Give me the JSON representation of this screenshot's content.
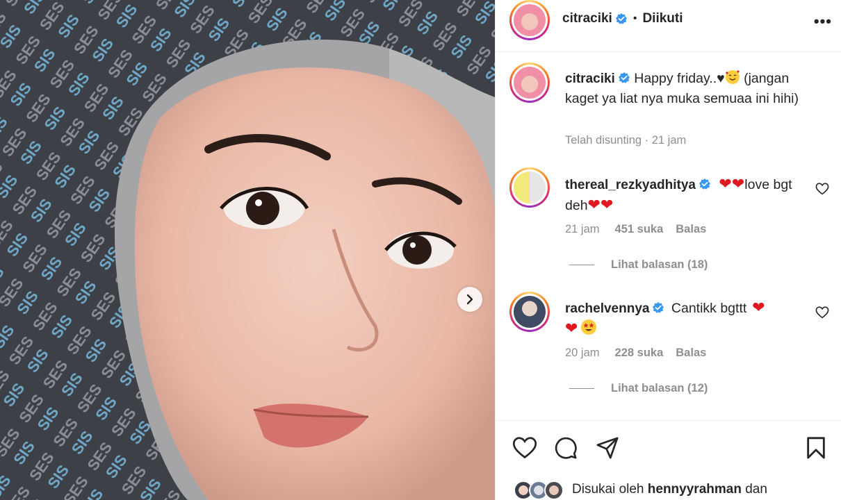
{
  "post": {
    "author": "citraciki",
    "follow_status": "Diikuti",
    "more_label": "•••",
    "caption_author": "citraciki",
    "caption_text": "Happy friday..",
    "caption_rest": "(jangan kaget ya liat nya muka semuaa ini hihi)",
    "caption_meta": "Telah disunting · 21 jam"
  },
  "comments": [
    {
      "user": "thereal_rezkyadhitya",
      "text_mid": "love bgt deh",
      "time": "21 jam",
      "likes": "451 suka",
      "reply": "Balas",
      "view_replies": "Lihat balasan (18)"
    },
    {
      "user": "rachelvennya",
      "text": "Cantikk bgttt",
      "time": "20 jam",
      "likes": "228 suka",
      "reply": "Balas",
      "view_replies": "Lihat balasan (12)"
    }
  ],
  "footer": {
    "liked_prefix": "Disukai oleh ",
    "liked_user": "hennyyrahman",
    "liked_suffix": " dan"
  },
  "colors": {
    "verified": "#3897f0",
    "heart_red": "#e0181f",
    "muted": "#8e8e8e"
  },
  "icons": [
    "chevron-right-icon",
    "verified-icon",
    "heart-icon",
    "comment-icon",
    "share-icon",
    "bookmark-icon",
    "more-icon"
  ]
}
